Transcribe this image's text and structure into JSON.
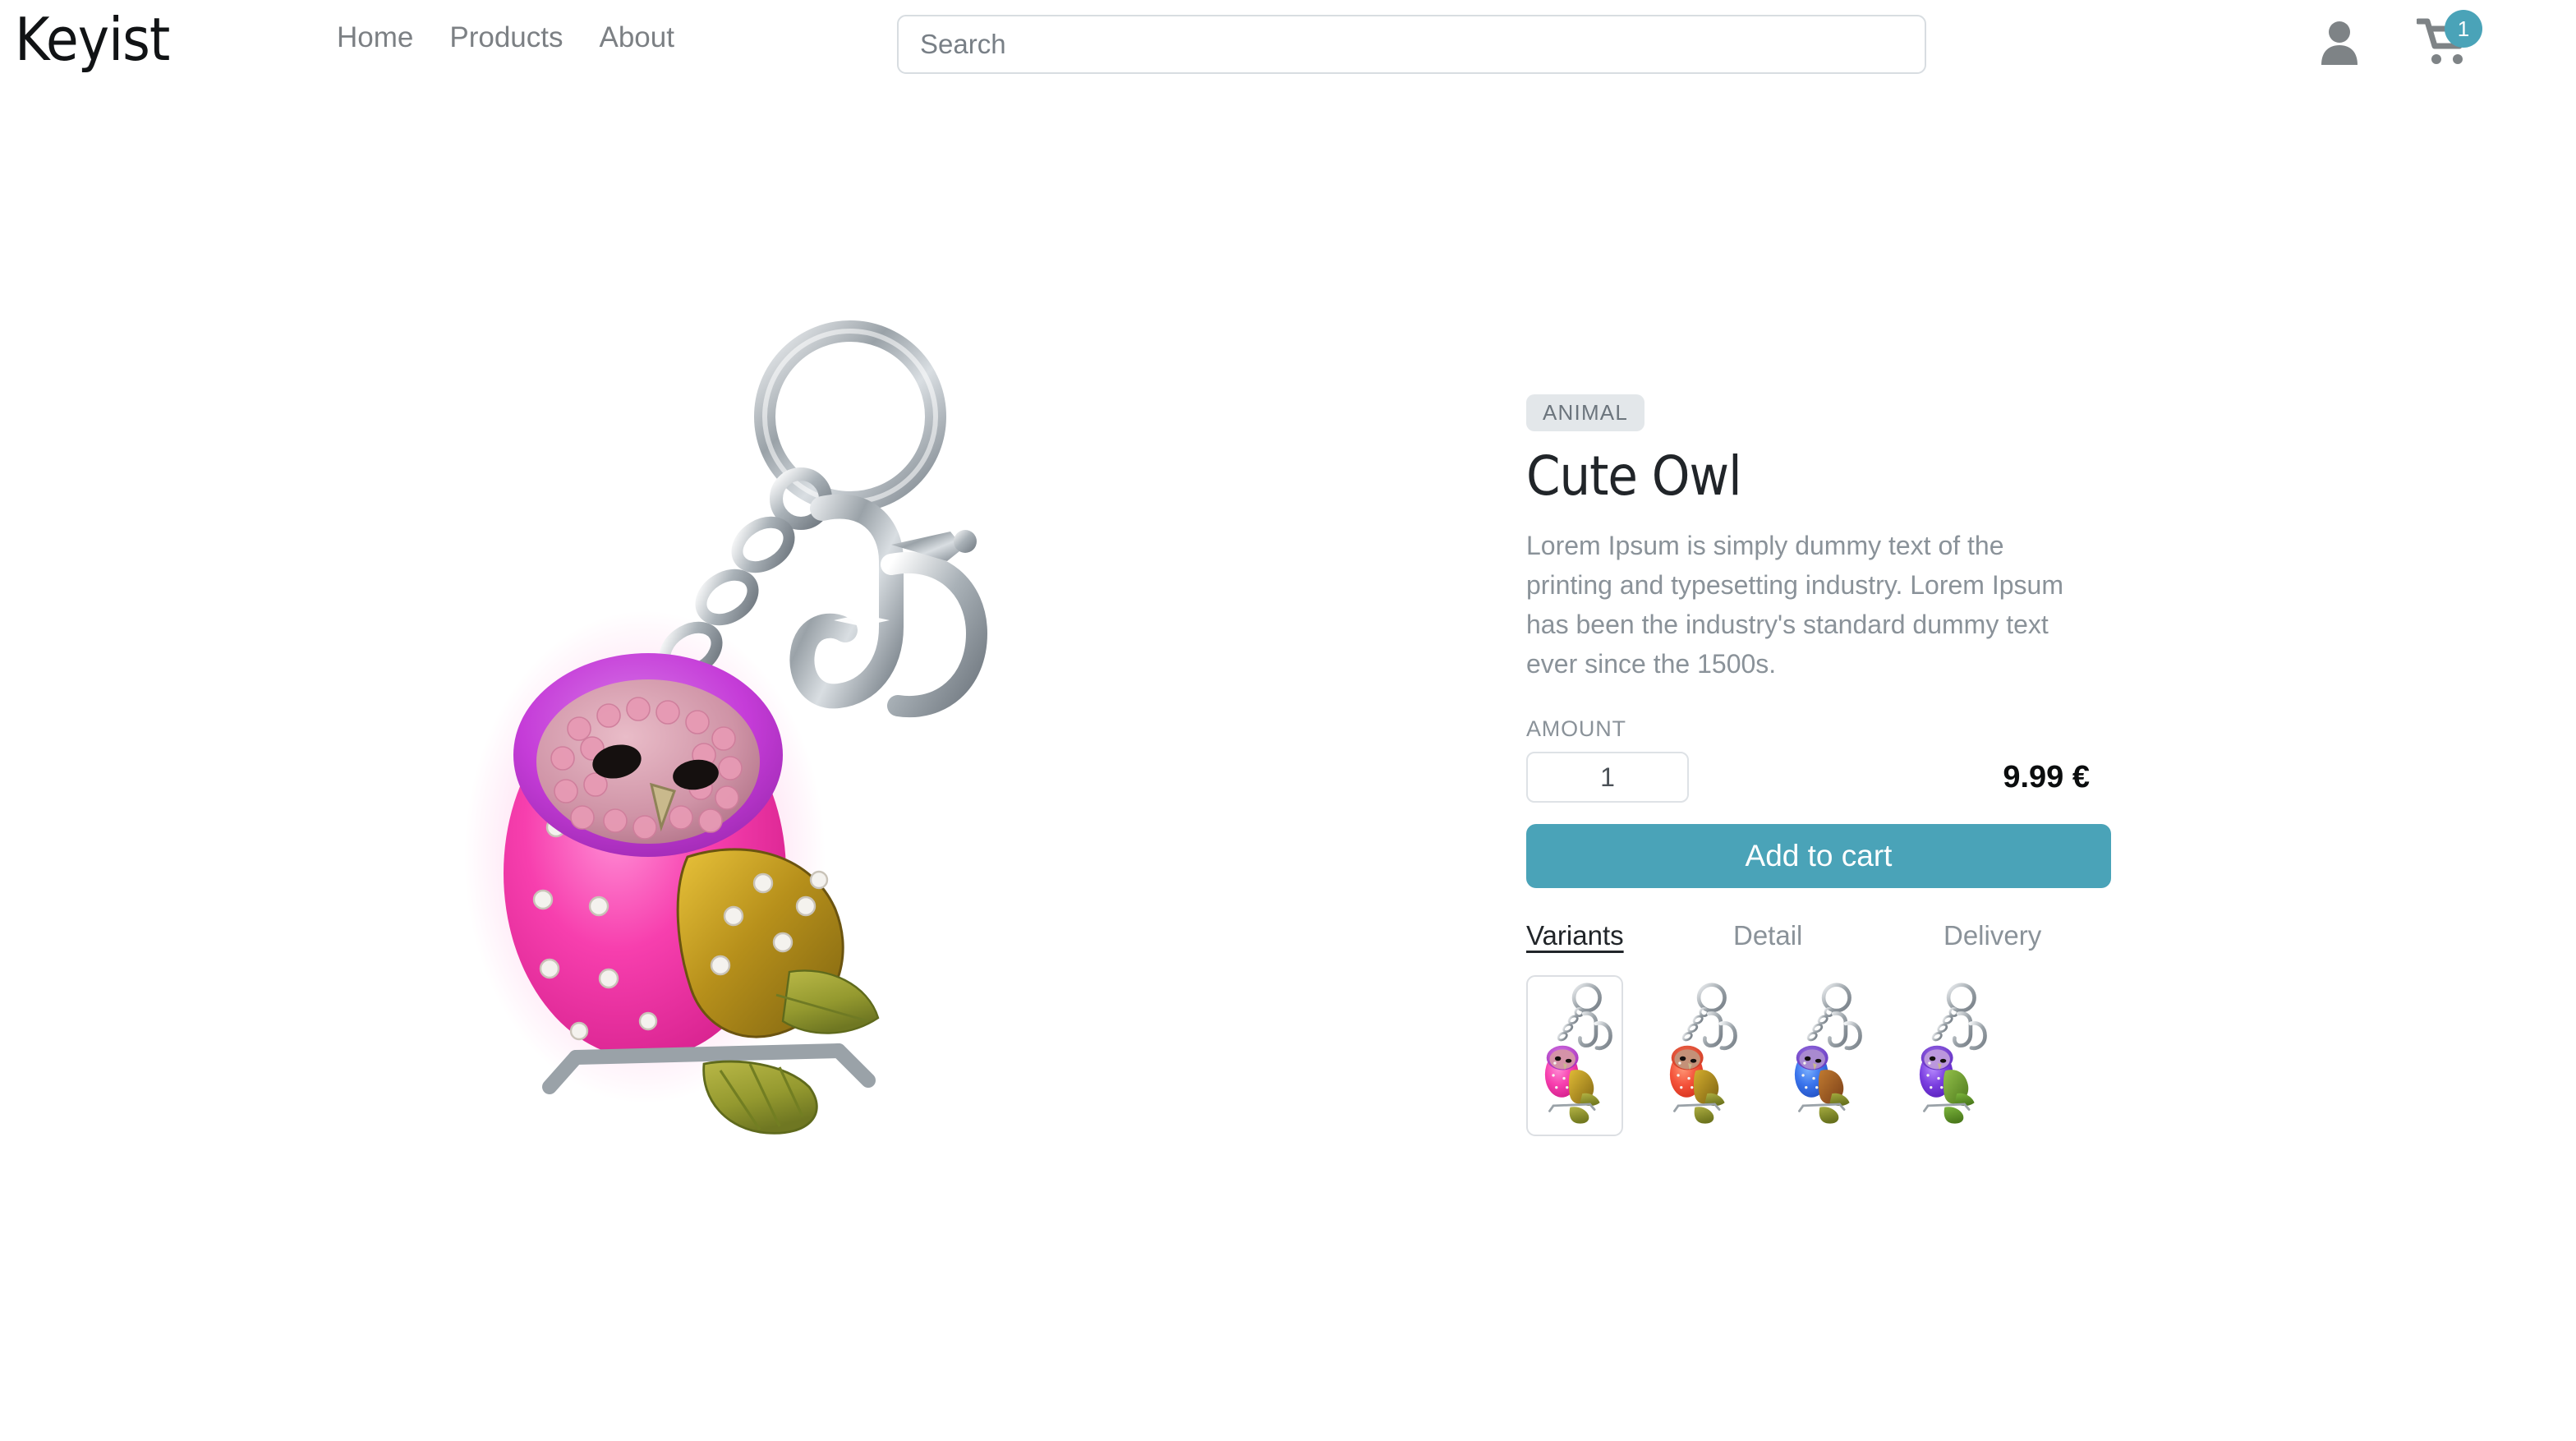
{
  "header": {
    "logo": "Keyist",
    "nav": [
      {
        "label": "Home"
      },
      {
        "label": "Products"
      },
      {
        "label": "About"
      }
    ],
    "search": {
      "placeholder": "Search",
      "value": "",
      "icon": "search-icon"
    },
    "account_icon": "user-icon",
    "cart_icon": "shopping-cart-icon",
    "cart_count": "1"
  },
  "product": {
    "category": "ANIMAL",
    "title": "Cute Owl",
    "description": "Lorem Ipsum is simply dummy text of the printing and typesetting industry. Lorem Ipsum has been the industry's standard dummy text ever since the 1500s.",
    "amount_label": "AMOUNT",
    "quantity": "1",
    "price": "9.99 €",
    "add_to_cart_label": "Add to cart",
    "main_image_alt": "Pink rhinestone owl keychain with silver key ring and lobster clasp"
  },
  "tabs": [
    {
      "label": "Variants",
      "active": true
    },
    {
      "label": "Detail",
      "active": false
    },
    {
      "label": "Delivery",
      "active": false
    }
  ],
  "variants": [
    {
      "name": "pink-owl-keychain",
      "selected": true,
      "body": "#ef3fb0",
      "body2": "#ff6fc4",
      "head": "#c23bd6",
      "face": "#d98fa8",
      "wing": "#b08a1a",
      "wing2": "#a8a63a",
      "tail": "#9aa038"
    },
    {
      "name": "orange-owl-keychain",
      "selected": false,
      "body": "#f4513a",
      "body2": "#ff8a6b",
      "head": "#e8412c",
      "face": "#c29078",
      "wing": "#a8891f",
      "wing2": "#9fa03a",
      "tail": "#949b36"
    },
    {
      "name": "blue-owl-keychain",
      "selected": false,
      "body": "#3a6fe8",
      "body2": "#5f9bf5",
      "head": "#6d4fd1",
      "face": "#9b7fc4",
      "wing": "#9d5a2a",
      "wing2": "#8e7a2c",
      "tail": "#8a9433"
    },
    {
      "name": "purple-owl-keychain",
      "selected": false,
      "body": "#7b3fe0",
      "body2": "#a06ff0",
      "head": "#6b35c9",
      "face": "#b08fd4",
      "wing": "#7fa83a",
      "wing2": "#6f9e2e",
      "tail": "#64922a"
    }
  ],
  "colors": {
    "accent": "#4aa3b8",
    "badge_bg": "#e3e7ea",
    "text_muted": "#8a9299",
    "text_dark": "#212529",
    "border": "#dee2e6"
  }
}
